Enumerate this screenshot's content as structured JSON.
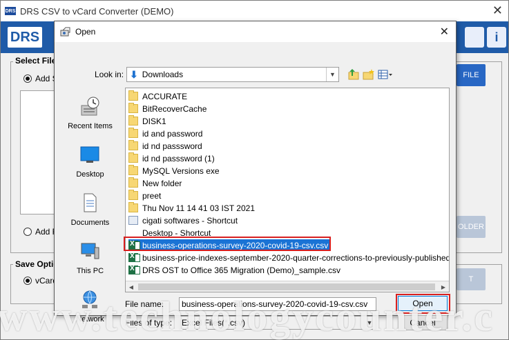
{
  "app": {
    "title": "DRS CSV to vCard Converter (DEMO)",
    "logo_small": "DRS",
    "logo": "DRS",
    "info_icon": "i",
    "select_group_title": "Select File",
    "add_radio_1": "Add S",
    "add_radio_2": "Add F",
    "right_btn_1": "FILE",
    "right_btn_2": "OLDER",
    "save_group_title": "Save Optio",
    "vcard_radio": "vCard",
    "right_btn_3": "T"
  },
  "dialog": {
    "title": "Open",
    "lookin_label": "Look in:",
    "lookin_value": "Downloads",
    "places": [
      {
        "label": "Recent Items",
        "icon": "recent-items-icon"
      },
      {
        "label": "Desktop",
        "icon": "desktop-icon"
      },
      {
        "label": "Documents",
        "icon": "documents-icon"
      },
      {
        "label": "This PC",
        "icon": "this-pc-icon"
      },
      {
        "label": "Network",
        "icon": "network-icon"
      }
    ],
    "files": [
      {
        "name": "ACCURATE",
        "type": "folder"
      },
      {
        "name": "BitRecoverCache",
        "type": "folder"
      },
      {
        "name": "DISK1",
        "type": "folder"
      },
      {
        "name": "id and password",
        "type": "folder"
      },
      {
        "name": "id nd passsword",
        "type": "folder"
      },
      {
        "name": "id nd passsword (1)",
        "type": "folder"
      },
      {
        "name": "MySQL Versions exe",
        "type": "folder"
      },
      {
        "name": "New folder",
        "type": "folder"
      },
      {
        "name": "preet",
        "type": "folder"
      },
      {
        "name": "Thu Nov 11 14 41 03 IST 2021",
        "type": "folder"
      },
      {
        "name": "cigati softwares - Shortcut",
        "type": "shortcut"
      },
      {
        "name": "Desktop - Shortcut",
        "type": "desktop"
      },
      {
        "name": "business-operations-survey-2020-covid-19-csv.csv",
        "type": "xls",
        "selected": true
      },
      {
        "name": "business-price-indexes-september-2020-quarter-corrections-to-previously-published",
        "type": "xls"
      },
      {
        "name": "DRS OST to Office 365 Migration (Demo)_sample.csv",
        "type": "xls"
      }
    ],
    "filename_label": "File name:",
    "filename_value": "business-operations-survey-2020-covid-19-csv.csv",
    "filetype_label": "Files of type:",
    "filetype_value": "Excel Files(*.csv)",
    "open_label": "Open",
    "cancel_label": "Cancel"
  },
  "watermark": "www.technologycounter.c",
  "colors": {
    "app_blue": "#1f5ba8",
    "selection": "#1a73d5",
    "highlight_red": "#d81e1e"
  }
}
